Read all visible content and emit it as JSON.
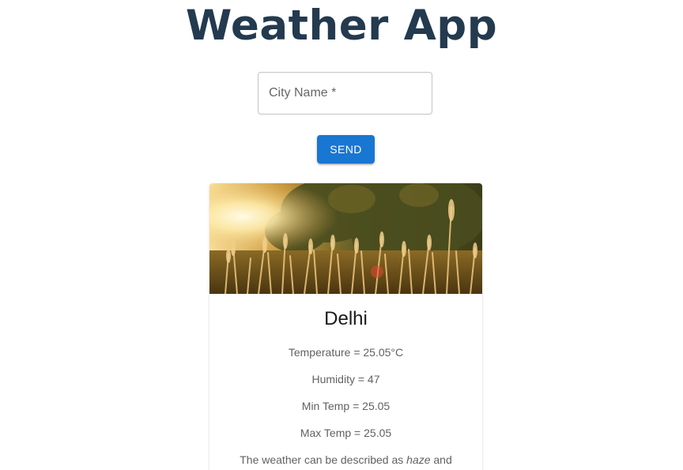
{
  "app": {
    "title": "Weather App"
  },
  "search": {
    "placeholder": "City Name *",
    "value": "",
    "send_label": "SEND"
  },
  "card": {
    "image_alt": "Sunlit field of tall grass with trees in the background",
    "city": "Delhi",
    "stats": [
      "Temperature = 25.05°C",
      "Humidity = 47",
      "Min Temp = 25.05",
      "Max Temp = 25.05"
    ],
    "description": {
      "prefix": "The weather can be described as",
      "condition": "haze",
      "suffix": "and"
    }
  },
  "colors": {
    "title": "#233a4f",
    "accent": "#1976d2",
    "text_secondary": "#616161"
  }
}
